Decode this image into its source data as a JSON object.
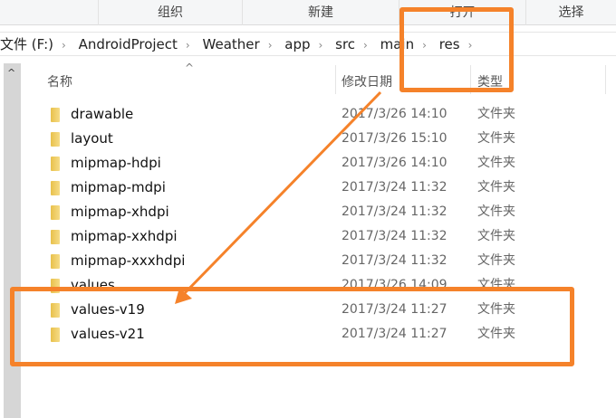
{
  "toolbar": {
    "groups": [
      "组织",
      "新建",
      "打开",
      "选择"
    ]
  },
  "breadcrumb": [
    "文件 (F:)",
    "AndroidProject",
    "Weather",
    "app",
    "src",
    "main",
    "res"
  ],
  "columns": {
    "name": "名称",
    "modified": "修改日期",
    "type": "类型"
  },
  "files": [
    {
      "name": "drawable",
      "date": "2017/3/26 14:10",
      "type": "文件夹"
    },
    {
      "name": "layout",
      "date": "2017/3/26 15:10",
      "type": "文件夹"
    },
    {
      "name": "mipmap-hdpi",
      "date": "2017/3/26 14:10",
      "type": "文件夹"
    },
    {
      "name": "mipmap-mdpi",
      "date": "2017/3/24 11:32",
      "type": "文件夹"
    },
    {
      "name": "mipmap-xhdpi",
      "date": "2017/3/24 11:32",
      "type": "文件夹"
    },
    {
      "name": "mipmap-xxhdpi",
      "date": "2017/3/24 11:32",
      "type": "文件夹"
    },
    {
      "name": "mipmap-xxxhdpi",
      "date": "2017/3/24 11:32",
      "type": "文件夹"
    },
    {
      "name": "values",
      "date": "2017/3/26 14:09",
      "type": "文件夹"
    },
    {
      "name": "values-v19",
      "date": "2017/3/24 11:27",
      "type": "文件夹"
    },
    {
      "name": "values-v21",
      "date": "2017/3/24 11:27",
      "type": "文件夹"
    }
  ],
  "annotation_color": "#f5822a"
}
